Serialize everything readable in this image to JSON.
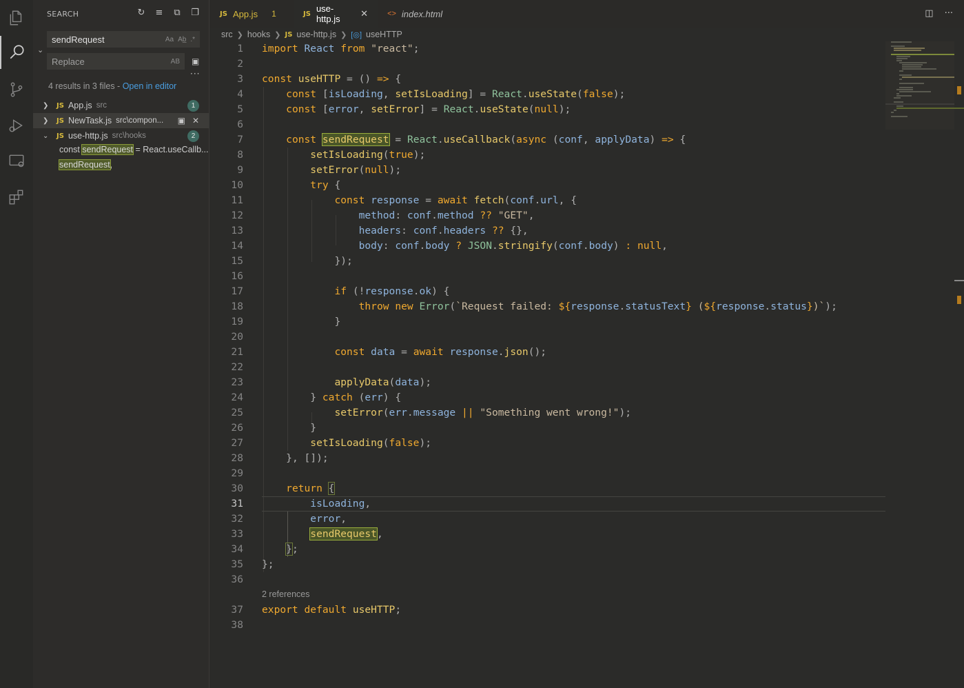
{
  "sidebar": {
    "title": "SEARCH",
    "search_value": "sendRequest",
    "search_opts": [
      "Aa",
      "Ab̲",
      ".*"
    ],
    "replace_placeholder": "Replace",
    "replace_opt": "AB",
    "results_text": "4 results in 3 files - ",
    "open_in_editor": "Open in editor",
    "files": [
      {
        "name": "App.js",
        "dir": "src",
        "count": "1",
        "expanded": false
      },
      {
        "name": "NewTask.js",
        "dir": "src\\compon...",
        "count": "",
        "expanded": false
      },
      {
        "name": "use-http.js",
        "dir": "src\\hooks",
        "count": "2",
        "expanded": true
      }
    ],
    "matches": [
      {
        "pre": "const ",
        "hit": "sendRequest",
        "post": " = React.useCallb..."
      },
      {
        "pre": "",
        "hit": "sendRequest",
        "post": ","
      }
    ]
  },
  "tabs": [
    {
      "label": "App.js",
      "type": "js",
      "count": "1"
    },
    {
      "label": "use-http.js",
      "type": "js",
      "active": true
    },
    {
      "label": "index.html",
      "type": "html"
    }
  ],
  "breadcrumb": {
    "parts": [
      "src",
      "hooks",
      "use-http.js"
    ],
    "symbol": "useHTTP"
  },
  "editor": {
    "codelens": "2 references",
    "line_numbers": [
      "1",
      "2",
      "3",
      "4",
      "5",
      "6",
      "7",
      "8",
      "9",
      "10",
      "11",
      "12",
      "13",
      "14",
      "15",
      "16",
      "17",
      "18",
      "19",
      "20",
      "21",
      "22",
      "23",
      "24",
      "25",
      "26",
      "27",
      "28",
      "29",
      "30",
      "31",
      "32",
      "33",
      "34",
      "35",
      "36",
      "37",
      "38"
    ],
    "current_line": 31
  },
  "colors": {
    "accent": "#4a9ee0",
    "js_icon": "#d7ba3d",
    "badge": "#3f6b62",
    "match_highlight": "#515c2a"
  }
}
